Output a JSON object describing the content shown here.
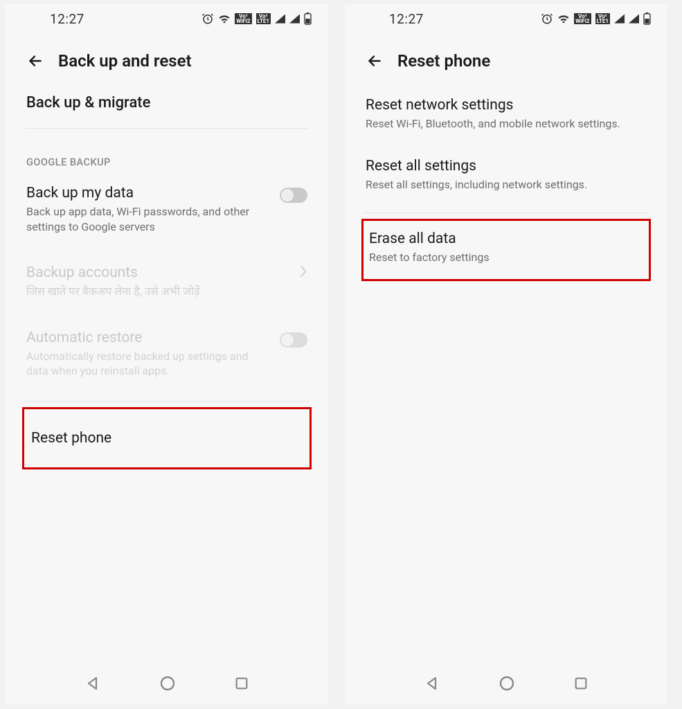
{
  "status": {
    "time": "12:27"
  },
  "left": {
    "header_title": "Back up and reset",
    "backup_migrate": "Back up & migrate",
    "section_google": "GOOGLE BACKUP",
    "backup_my_data": {
      "title": "Back up my data",
      "sub": "Back up app data, Wi-Fi passwords, and other settings to Google servers"
    },
    "backup_accounts": {
      "title": "Backup accounts",
      "sub": "जिस खाते पर बैकअप लेना है, उसे अभी जोड़ें"
    },
    "auto_restore": {
      "title": "Automatic restore",
      "sub": "Automatically restore backed up settings and data when you reinstall apps."
    },
    "reset_phone": "Reset phone"
  },
  "right": {
    "header_title": "Reset phone",
    "reset_network": {
      "title": "Reset network settings",
      "sub": "Reset Wi-Fi, Bluetooth, and mobile network settings."
    },
    "reset_all": {
      "title": "Reset all settings",
      "sub": "Reset all settings, including network settings."
    },
    "erase_all": {
      "title": "Erase all data",
      "sub": "Reset to factory settings"
    }
  }
}
